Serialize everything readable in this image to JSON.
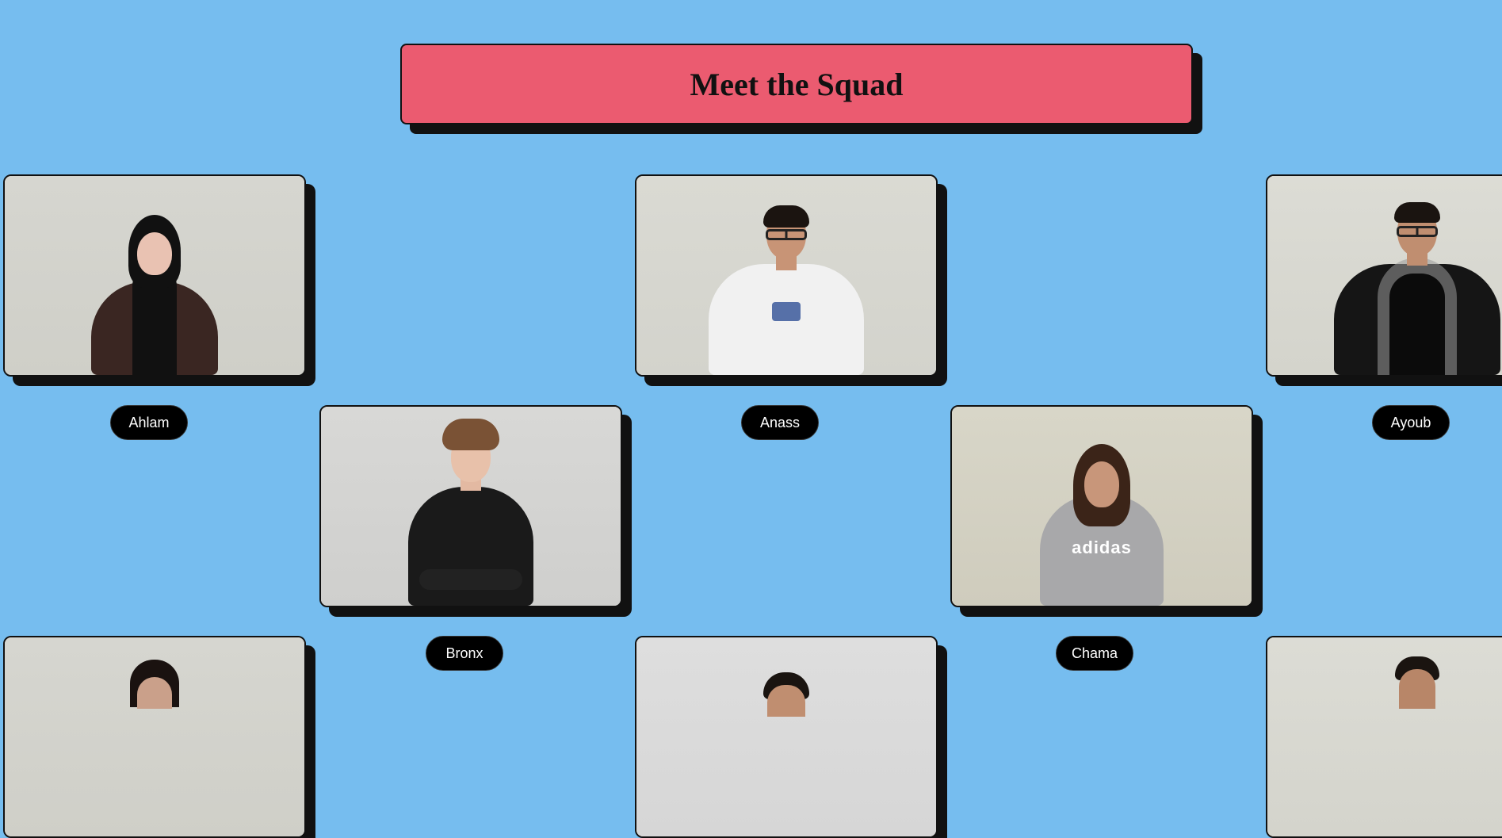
{
  "page": {
    "title": "Meet the Squad"
  },
  "members": [
    {
      "name": "Ahlam"
    },
    {
      "name": "Bronx"
    },
    {
      "name": "Anass"
    },
    {
      "name": "Chama"
    },
    {
      "name": "Ayoub"
    }
  ],
  "colors": {
    "background": "#76bdef",
    "banner": "#eb5b70",
    "pill": "#000000",
    "shadow": "#111111"
  },
  "icons": {
    "hoodie_print": "adidas"
  }
}
